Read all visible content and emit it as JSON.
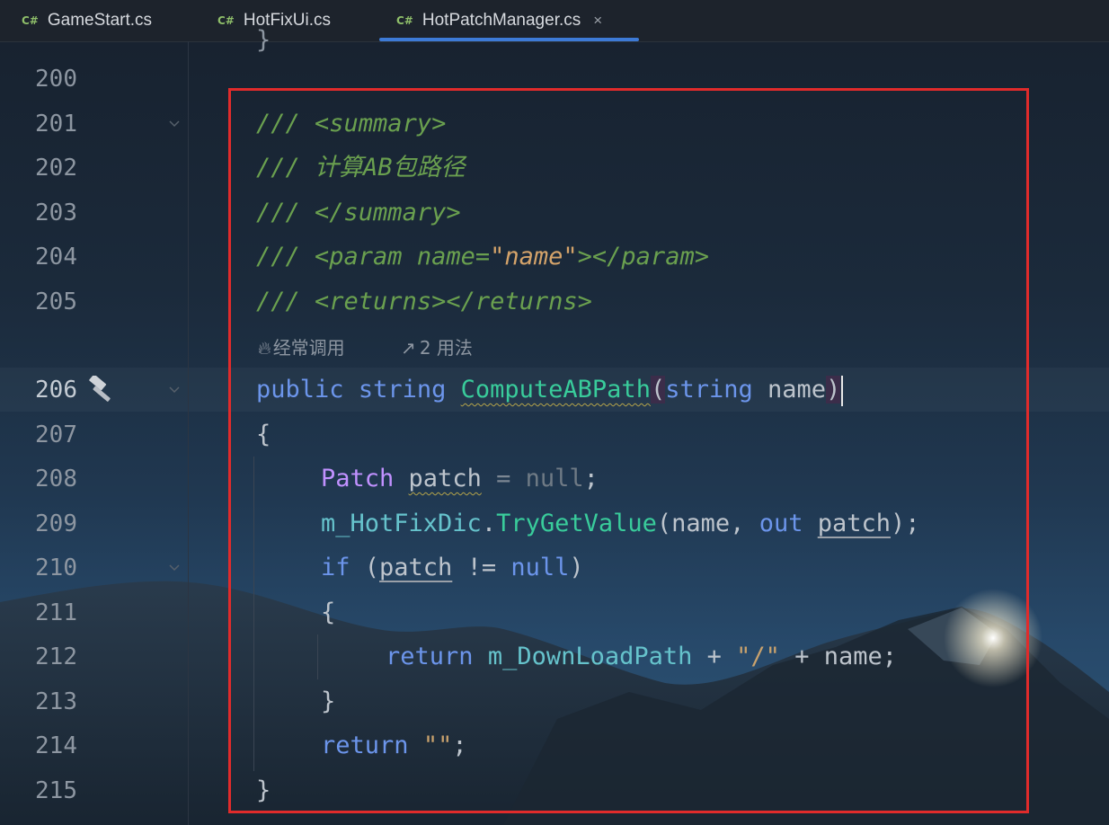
{
  "tabs": [
    {
      "lang": "C#",
      "label": "GameStart.cs"
    },
    {
      "lang": "C#",
      "label": "HotFixUi.cs"
    },
    {
      "lang": "C#",
      "label": "HotPatchManager.cs",
      "active": true,
      "close": "×"
    }
  ],
  "gutter": {
    "lines": [
      "200",
      "201",
      "202",
      "203",
      "204",
      "205",
      "206",
      "207",
      "208",
      "209",
      "210",
      "211",
      "212",
      "213",
      "214",
      "215"
    ],
    "gutter_icon": "hammer-icon"
  },
  "codelens": {
    "usage_hint": "经常调用",
    "usages": "2 用法"
  },
  "code": {
    "l201": {
      "a": "/// ",
      "b": "<summary>"
    },
    "l202": {
      "a": "/// 计算AB包路径"
    },
    "l203": {
      "a": "/// ",
      "b": "</summary>"
    },
    "l204": {
      "a": "/// ",
      "b": "<param name=",
      "c": "\"name\"",
      "d": "></param>"
    },
    "l205": {
      "a": "/// ",
      "b": "<returns></returns>"
    },
    "l206": {
      "kw1": "public",
      "kw2": "string",
      "fn": "ComputeABPath",
      "lp": "(",
      "kw3": "string",
      "arg": "name",
      "rp": ")"
    },
    "l207": {
      "t": "{"
    },
    "l208": {
      "ty": "Patch",
      "var": "patch",
      "eq": " = ",
      "nul": "null",
      "semi": ";"
    },
    "l209": {
      "field": "m_HotFixDic",
      "dot": ".",
      "fn": "TryGetValue",
      "a": "(name, ",
      "kw": "out",
      "var": "patch",
      "b": ");"
    },
    "l210": {
      "kw": "if",
      "a": " (",
      "var": "patch",
      "b": " != ",
      "nul": "null",
      "c": ")"
    },
    "l211": {
      "t": "{"
    },
    "l212": {
      "kw": "return",
      "field": "m_DownLoadPath",
      "a": " + ",
      "str": "\"/\"",
      "b": " + name;"
    },
    "l213": {
      "t": "}"
    },
    "l214": {
      "kw": "return",
      "str": "\"\"",
      "semi": ";"
    },
    "l215": {
      "t": "}"
    }
  },
  "colors": {
    "accent": "#3d7ad6",
    "highlight_box": "#e02b2b",
    "comment": "#6aa04f",
    "keyword": "#6c95eb",
    "method": "#39cc9b",
    "type": "#c191ff"
  }
}
